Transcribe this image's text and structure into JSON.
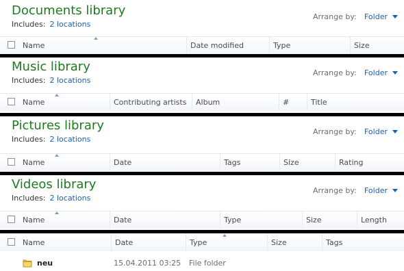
{
  "libraries": [
    {
      "title": "Documents library",
      "includes_label": "Includes:",
      "locations_link": "2 locations",
      "arrange_label": "Arrange by:",
      "arrange_value": "Folder",
      "columns": [
        "Name",
        "Date modified",
        "Type",
        "Size"
      ]
    },
    {
      "title": "Music library",
      "includes_label": "Includes:",
      "locations_link": "2 locations",
      "arrange_label": "Arrange by:",
      "arrange_value": "Folder",
      "columns": [
        "Name",
        "Contributing artists",
        "Album",
        "#",
        "Title"
      ]
    },
    {
      "title": "Pictures library",
      "includes_label": "Includes:",
      "locations_link": "2 locations",
      "arrange_label": "Arrange by:",
      "arrange_value": "Folder",
      "columns": [
        "Name",
        "Date",
        "Tags",
        "Size",
        "Rating"
      ]
    },
    {
      "title": "Videos library",
      "includes_label": "Includes:",
      "locations_link": "2 locations",
      "arrange_label": "Arrange by:",
      "arrange_value": "Folder",
      "columns": [
        "Name",
        "Date",
        "Type",
        "Size",
        "Length"
      ]
    }
  ],
  "folder_view": {
    "columns": [
      "Name",
      "Date",
      "Type",
      "Size",
      "Tags"
    ],
    "rows": [
      {
        "name": "neu",
        "date": "15.04.2011 03:25",
        "type": "File folder",
        "icon": "folder-icon"
      }
    ]
  },
  "colors": {
    "title_green": "#1e7a1e",
    "link_blue": "#1a5fb4"
  }
}
